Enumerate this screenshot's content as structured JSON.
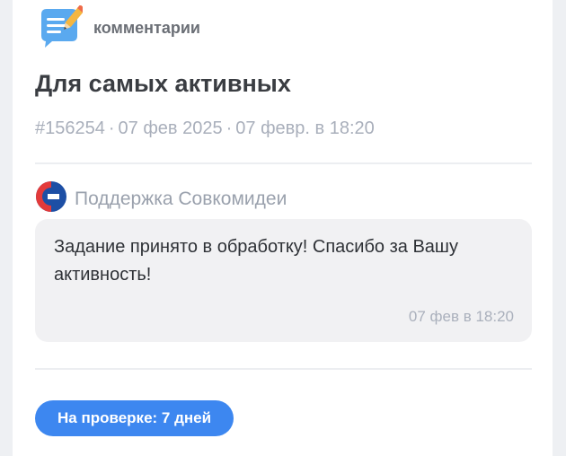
{
  "category": {
    "icon": "comments-notepad-icon",
    "label": "комментарии"
  },
  "task": {
    "title": "Для самых активных",
    "id": "#156254",
    "date": "07 фев 2025",
    "datetime": "07 февр. в 18:20",
    "separator": "·"
  },
  "comment": {
    "author_logo": "sovcombank-logo",
    "author": "Поддержка Совкомидеи",
    "text": "Задание принято в обработку! Спасибо за Вашу активность!",
    "time": "07 фев в 18:20"
  },
  "status": {
    "label": "На проверке: 7 дней",
    "color": "#3d87f0"
  }
}
